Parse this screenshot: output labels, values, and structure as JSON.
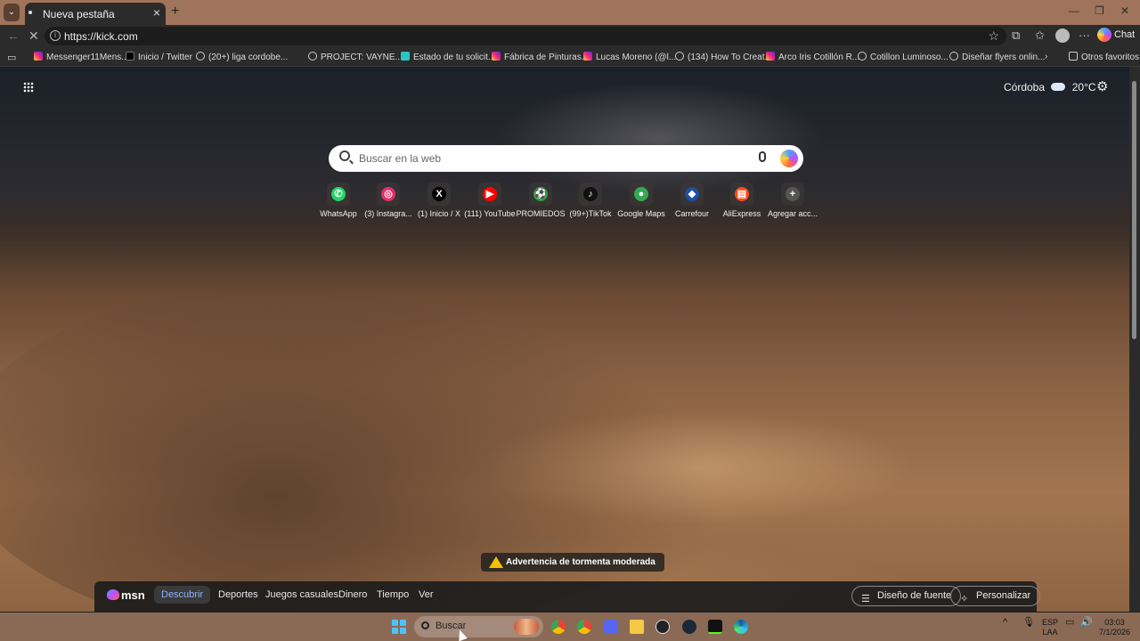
{
  "browser": {
    "tab_title": "Nueva pestaña",
    "url": "https://kick.com",
    "chat_label": "Chat",
    "other_favorites": "Otros favoritos",
    "bookmarks": [
      {
        "label": "Messenger11Mens...",
        "icon": "instagram-icon"
      },
      {
        "label": "Inicio / Twitter",
        "icon": "x-icon"
      },
      {
        "label": "(20+) liga cordobe...",
        "icon": "globe-icon"
      },
      {
        "label": "PROJECT: VAYNE...",
        "icon": "globe-icon"
      },
      {
        "label": "Estado de tu solicit...",
        "icon": "figma-icon"
      },
      {
        "label": "Fábrica de Pinturas...",
        "icon": "instagram-icon"
      },
      {
        "label": "Lucas Moreno (@l...",
        "icon": "instagram-icon"
      },
      {
        "label": "(134) How To Creat...",
        "icon": "globe-icon"
      },
      {
        "label": "Arco Iris Cotillón R...",
        "icon": "instagram-icon"
      },
      {
        "label": "Cotillon Luminoso...",
        "icon": "globe-icon"
      },
      {
        "label": "Diseñar flyers onlin...",
        "icon": "globe-icon"
      }
    ]
  },
  "newtab": {
    "weather": {
      "city": "Córdoba",
      "temp": "20°C"
    },
    "search_placeholder": "Buscar en la web",
    "quick_links": [
      {
        "label": "WhatsApp",
        "color": "#25d366",
        "glyph": "✆"
      },
      {
        "label": "(3) Instagra...",
        "color": "#e1306c",
        "glyph": "◎"
      },
      {
        "label": "(1) Inicio / X",
        "color": "#000000",
        "glyph": "X"
      },
      {
        "label": "(111) YouTube",
        "color": "#ff0000",
        "glyph": "▶"
      },
      {
        "label": "PROMIEDOS",
        "color": "#2e9e3e",
        "glyph": "⚽"
      },
      {
        "label": "(99+)TikTok",
        "color": "#111111",
        "glyph": "♪"
      },
      {
        "label": "Google Maps",
        "color": "#34a853",
        "glyph": "●"
      },
      {
        "label": "Carrefour",
        "color": "#1f4fa0",
        "glyph": "◆"
      },
      {
        "label": "AliExpress",
        "color": "#ff4a1a",
        "glyph": "▤"
      },
      {
        "label": "Agregar acc...",
        "color": "#555555",
        "glyph": "+"
      }
    ],
    "warning": "Advertencia de tormenta moderada",
    "msn": {
      "logo": "msn",
      "tabs": [
        "Descubrir",
        "Deportes",
        "Juegos casuales",
        "Dinero",
        "Tiempo",
        "Ver"
      ],
      "font_design": "Diseño de fuente",
      "personalize": "Personalizar"
    }
  },
  "taskbar": {
    "search": "Buscar",
    "lang1": "ESP",
    "lang2": "LAA",
    "time": "03:03",
    "date": "7/1/2026"
  }
}
